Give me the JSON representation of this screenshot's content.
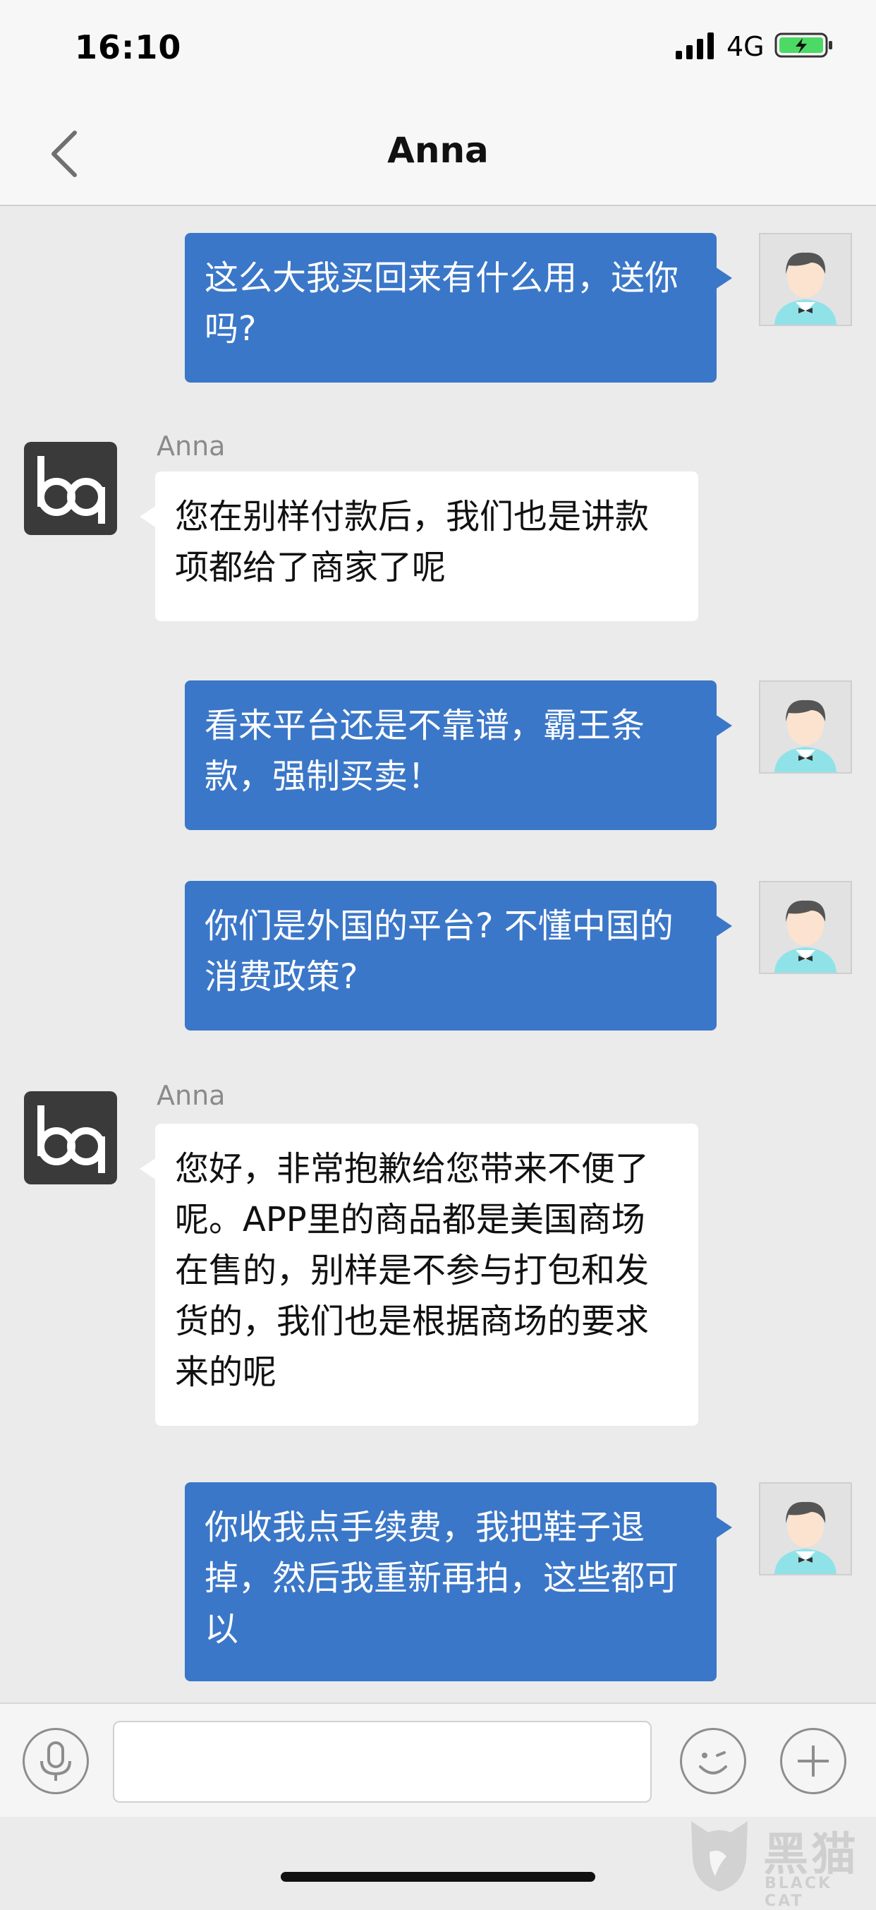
{
  "status_bar": {
    "time": "16:10",
    "network": "4G"
  },
  "nav": {
    "title": "Anna"
  },
  "messages": [
    {
      "side": "out",
      "text": "这么大我买回来有什么用，送你吗?"
    },
    {
      "side": "in",
      "sender": "Anna",
      "text": "您在别样付款后，我们也是讲款项都给了商家了呢"
    },
    {
      "side": "out",
      "text": "看来平台还是不靠谱，霸王条款，强制买卖！"
    },
    {
      "side": "out",
      "text": "你们是外国的平台? 不懂中国的消费政策?"
    },
    {
      "side": "in",
      "sender": "Anna",
      "text": "您好，非常抱歉给您带来不便了呢。APP里的商品都是美国商场在售的，别样是不参与打包和发货的，我们也是根据商场的要求来的呢"
    },
    {
      "side": "out",
      "text": "你收我点手续费，我把鞋子退掉，然后我重新再拍，这些都可以"
    }
  ],
  "input": {
    "value": ""
  },
  "watermark": {
    "logo_text": "黑猫",
    "sub_text": "BLACK CAT"
  },
  "colors": {
    "outgoing_bubble": "#3b77c8",
    "incoming_bubble": "#ffffff",
    "background": "#ebebeb"
  }
}
